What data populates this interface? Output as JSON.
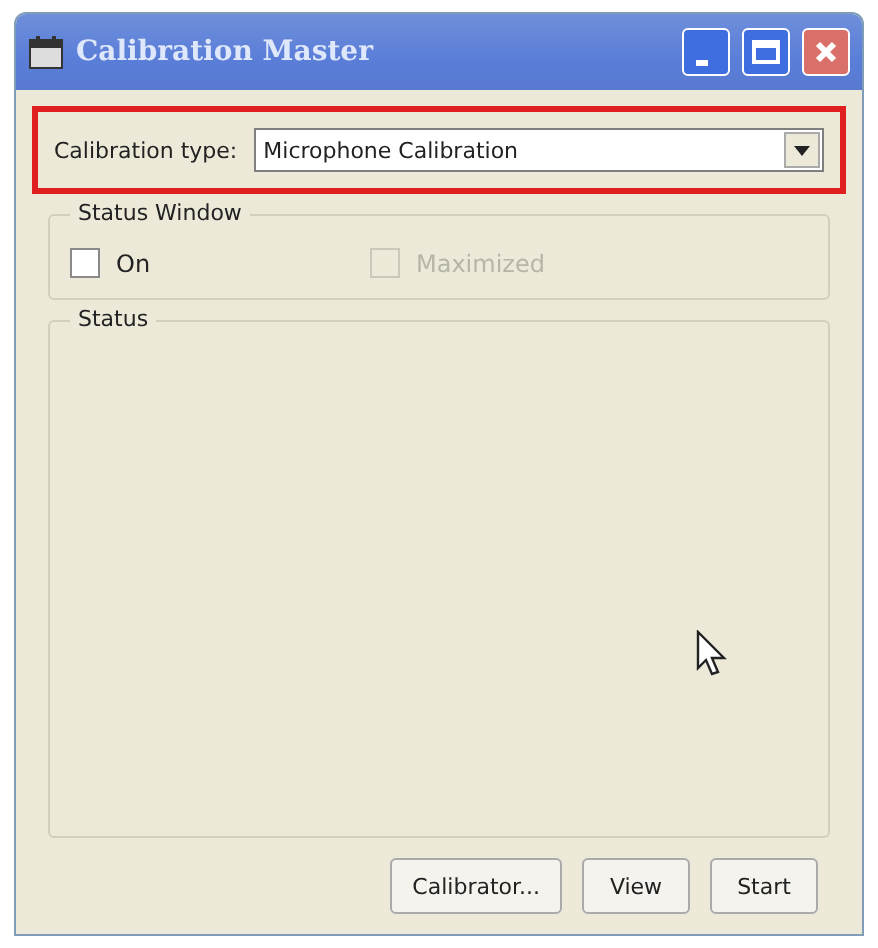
{
  "window": {
    "title": "Calibration Master"
  },
  "calibration_type": {
    "label": "Calibration type:",
    "value": "Microphone Calibration",
    "highlighted": true
  },
  "status_window": {
    "title": "Status Window",
    "options": [
      {
        "label": "On",
        "checked": false,
        "disabled": false
      },
      {
        "label": "Maximized",
        "checked": false,
        "disabled": true
      }
    ]
  },
  "status": {
    "title": "Status"
  },
  "buttons": [
    "Calibrator...",
    "View",
    "Start"
  ]
}
